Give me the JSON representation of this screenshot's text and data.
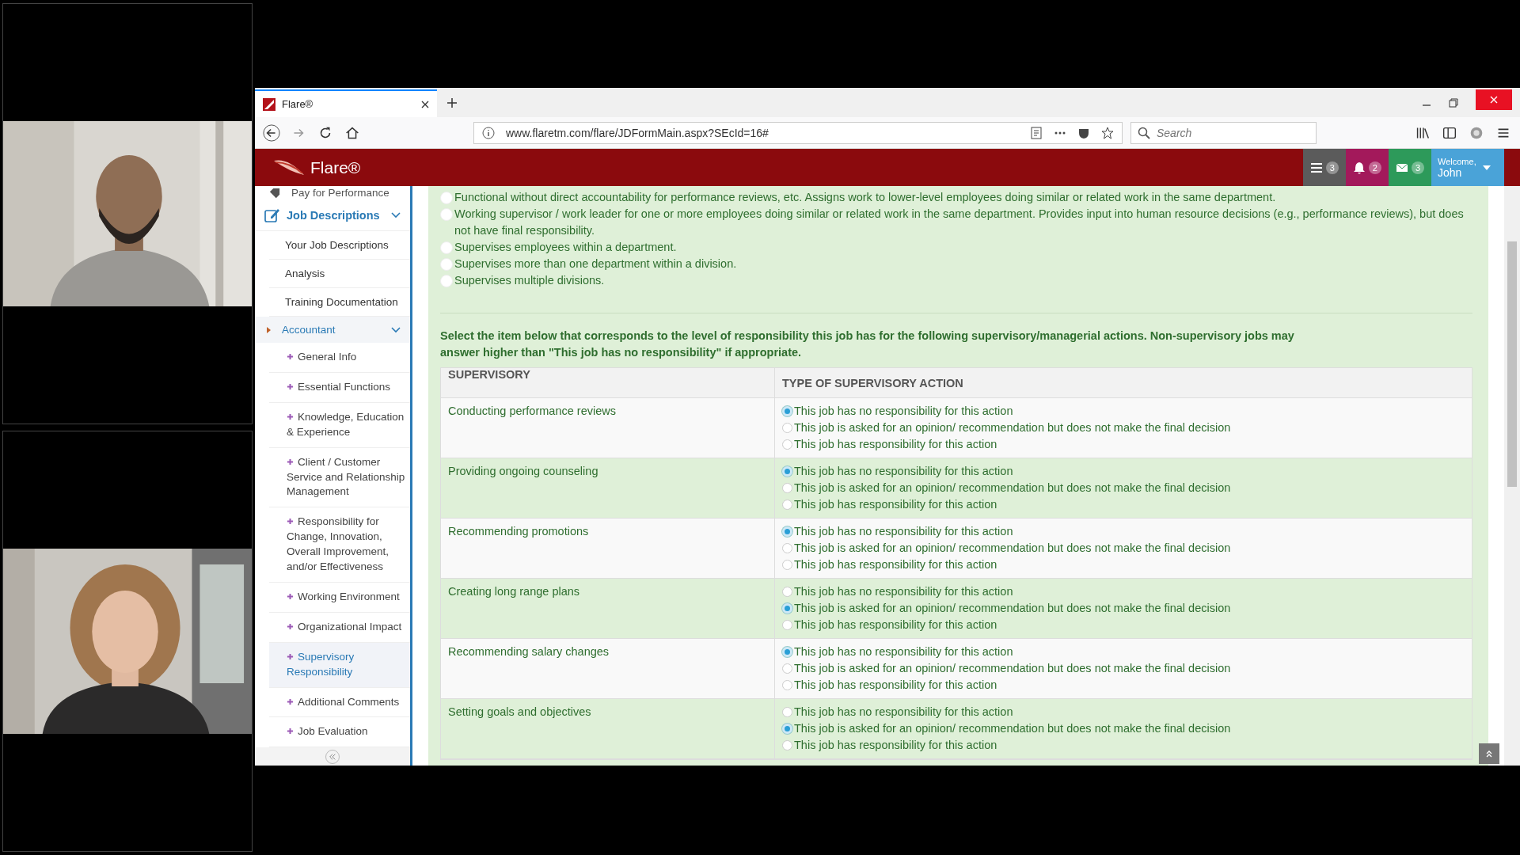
{
  "browser": {
    "tab_title": "Flare®",
    "url": "www.flaretm.com/flare/JDFormMain.aspx?SEcId=16#",
    "search": {
      "placeholder": "Search"
    }
  },
  "app_header": {
    "brand": "Flare®",
    "badges": [
      {
        "kind": "tasks",
        "count": "3",
        "color": "#5b5b5b"
      },
      {
        "kind": "alerts",
        "count": "2",
        "color": "#a3195b"
      },
      {
        "kind": "messages",
        "count": "3",
        "color": "#2d9a5a"
      }
    ],
    "welcome": "Welcome,",
    "user": "John"
  },
  "sidebar": {
    "top_item": "Pay for Performance",
    "section": {
      "label": "Job Descriptions",
      "expanded": true
    },
    "items": [
      "Your Job Descriptions",
      "Analysis",
      "Training Documentation"
    ],
    "job": {
      "label": "Accountant",
      "expanded": true
    },
    "job_sections": [
      {
        "label": "General Info",
        "selected": false
      },
      {
        "label": "Essential Functions",
        "selected": false
      },
      {
        "label": "Knowledge, Education & Experience",
        "selected": false
      },
      {
        "label": "Client / Customer Service and Relationship Management",
        "selected": false
      },
      {
        "label": "Responsibility for Change, Innovation, Overall Improvement, and/or Effectiveness",
        "selected": false
      },
      {
        "label": "Working Environment",
        "selected": false
      },
      {
        "label": "Organizational Impact",
        "selected": false
      },
      {
        "label": "Supervisory Responsibility",
        "selected": true
      },
      {
        "label": "Additional Comments",
        "selected": false
      },
      {
        "label": "Job Evaluation",
        "selected": false
      }
    ]
  },
  "supervision_options": [
    {
      "label": "Functional without direct accountability for performance reviews, etc. Assigns work to lower-level employees doing similar or related work in the same department.",
      "selected": false
    },
    {
      "label": "Working supervisor / work leader for one or more employees doing similar or related work in the same department. Provides input into human resource decisions (e.g., performance reviews), but does not have final responsibility.",
      "selected": false
    },
    {
      "label": "Supervises employees within a department.",
      "selected": false
    },
    {
      "label": "Supervises more than one department within a division.",
      "selected": false
    },
    {
      "label": "Supervises multiple divisions.",
      "selected": false
    }
  ],
  "instruction": "Select the item below that corresponds to the level of responsibility this job has for the following supervisory/managerial actions. Non-supervisory jobs may answer higher than \"This job has no responsibility\" if appropriate.",
  "table": {
    "columns": [
      "SUPERVISORY",
      "TYPE OF SUPERVISORY ACTION"
    ],
    "rows": [
      {
        "label": "Conducting performance reviews",
        "options": [
          {
            "label": "This job has no responsibility for this action",
            "selected": true
          },
          {
            "label": "This job is asked for an opinion/ recommendation but does not make the final decision",
            "selected": false
          },
          {
            "label": "This job has responsibility for this action",
            "selected": false
          }
        ]
      },
      {
        "label": "Providing ongoing counseling",
        "options": [
          {
            "label": "This job has no responsibility for this action",
            "selected": true
          },
          {
            "label": "This job is asked for an opinion/ recommendation but does not make the final decision",
            "selected": false
          },
          {
            "label": "This job has responsibility for this action",
            "selected": false
          }
        ]
      },
      {
        "label": "Recommending promotions",
        "options": [
          {
            "label": "This job has no responsibility for this action",
            "selected": true
          },
          {
            "label": "This job is asked for an opinion/ recommendation but does not make the final decision",
            "selected": false
          },
          {
            "label": "This job has responsibility for this action",
            "selected": false
          }
        ]
      },
      {
        "label": "Creating long range plans",
        "options": [
          {
            "label": "This job has no responsibility for this action",
            "selected": false
          },
          {
            "label": "This job is asked for an opinion/ recommendation but does not make the final decision",
            "selected": true
          },
          {
            "label": "This job has responsibility for this action",
            "selected": false
          }
        ]
      },
      {
        "label": "Recommending salary changes",
        "options": [
          {
            "label": "This job has no responsibility for this action",
            "selected": true
          },
          {
            "label": "This job is asked for an opinion/ recommendation but does not make the final decision",
            "selected": false
          },
          {
            "label": "This job has responsibility for this action",
            "selected": false
          }
        ]
      },
      {
        "label": "Setting goals and objectives",
        "options": [
          {
            "label": "This job has no responsibility for this action",
            "selected": false
          },
          {
            "label": "This job is asked for an opinion/ recommendation but does not make the final decision",
            "selected": true
          },
          {
            "label": "This job has responsibility for this action",
            "selected": false
          }
        ]
      }
    ]
  }
}
